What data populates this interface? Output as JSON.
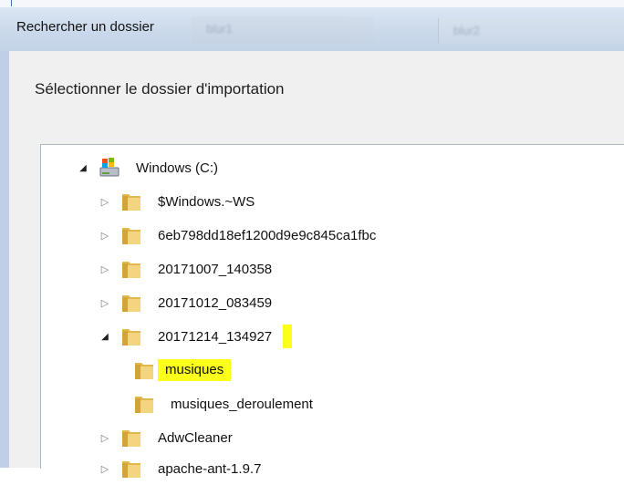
{
  "window": {
    "title": "Rechercher un dossier",
    "background_tabs": [
      "blur1",
      "blur2"
    ]
  },
  "dialog": {
    "prompt": "Sélectionner le dossier d'importation"
  },
  "tree": {
    "root": {
      "label": "Windows (C:)",
      "icon": "drive-icon",
      "expanded": true
    },
    "items": [
      {
        "label": "$Windows.~WS",
        "expanded": false
      },
      {
        "label": "6eb798dd18ef1200d9e9c845ca1fbc",
        "expanded": false
      },
      {
        "label": "20171007_140358",
        "expanded": false
      },
      {
        "label": "20171012_083459",
        "expanded": false
      },
      {
        "label": "20171214_134927",
        "expanded": true,
        "highlight": true
      },
      {
        "label": "musiques",
        "child": true,
        "highlight": true
      },
      {
        "label": "musiques_deroulement",
        "child": true
      },
      {
        "label": "AdwCleaner",
        "expanded": false
      },
      {
        "label": "apache-ant-1.9.7",
        "expanded": false
      }
    ]
  },
  "colors": {
    "highlight": "#fbff1a",
    "titlebar": "#c9d8ea",
    "folder": "#e8c766"
  }
}
